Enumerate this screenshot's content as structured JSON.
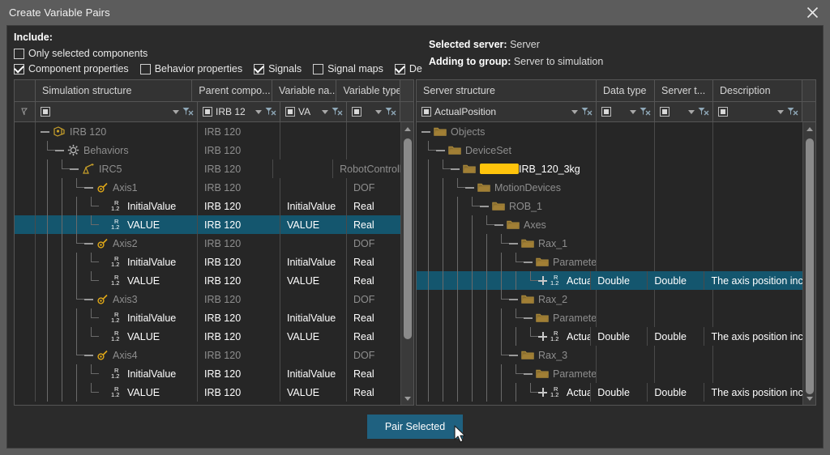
{
  "window": {
    "title": "Create Variable Pairs",
    "close_icon": "close-icon"
  },
  "include": {
    "label": "Include:",
    "checkboxes": [
      {
        "label": "Only selected components",
        "checked": false
      },
      {
        "label": "Component properties",
        "checked": true
      },
      {
        "label": "Behavior properties",
        "checked": false
      },
      {
        "label": "Signals",
        "checked": true
      },
      {
        "label": "Signal maps",
        "checked": false
      },
      {
        "label": "Degrees of",
        "checked": true
      }
    ]
  },
  "server_info": {
    "selected_server_label": "Selected server:",
    "selected_server_value": "Server",
    "adding_to_group_label": "Adding to group:",
    "adding_to_group_value": "Server to simulation"
  },
  "left_panel": {
    "columns": [
      "Simulation structure",
      "Parent compo...",
      "Variable na...",
      "Variable type"
    ],
    "filters": [
      {
        "value": "",
        "icon": "filter-box-icon",
        "clear_icon": "clear-filter-icon"
      },
      {
        "value": "IRB 12",
        "icon": "filter-box-icon",
        "clear_icon": "clear-filter-icon"
      },
      {
        "value": "VA",
        "icon": "filter-box-icon",
        "clear_icon": "clear-filter-icon"
      },
      {
        "value": "",
        "icon": "filter-box-icon",
        "clear_icon": "clear-filter-icon"
      }
    ],
    "rows": [
      {
        "name": "IRB 120",
        "depth": 0,
        "icon": "robot-component-icon",
        "expander": "minus",
        "dim": true,
        "parent": "IRB 120",
        "varname": "",
        "vartype": "",
        "selected": false
      },
      {
        "name": "Behaviors",
        "depth": 1,
        "icon": "gear-icon",
        "expander": "minus",
        "dim": true,
        "parent": "IRB 120",
        "varname": "",
        "vartype": "",
        "selected": false
      },
      {
        "name": "IRC5",
        "depth": 2,
        "icon": "controller-icon",
        "expander": "minus",
        "dim": true,
        "parent": "IRB 120",
        "varname": "",
        "vartype": "RobotControlle",
        "selected": false
      },
      {
        "name": "Axis1",
        "depth": 3,
        "icon": "axis-icon",
        "expander": "minus",
        "dim": true,
        "parent": "IRB 120",
        "varname": "",
        "vartype": "DOF",
        "selected": false
      },
      {
        "name": "InitialValue",
        "depth": 4,
        "icon": "real-variable-icon",
        "expander": "none",
        "dim": false,
        "parent": "IRB 120",
        "varname": "InitialValue",
        "vartype": "Real",
        "selected": false
      },
      {
        "name": "VALUE",
        "depth": 4,
        "icon": "real-variable-icon",
        "expander": "none",
        "dim": false,
        "parent": "IRB 120",
        "varname": "VALUE",
        "vartype": "Real",
        "selected": true
      },
      {
        "name": "Axis2",
        "depth": 3,
        "icon": "axis-icon",
        "expander": "minus",
        "dim": true,
        "parent": "IRB 120",
        "varname": "",
        "vartype": "DOF",
        "selected": false
      },
      {
        "name": "InitialValue",
        "depth": 4,
        "icon": "real-variable-icon",
        "expander": "none",
        "dim": false,
        "parent": "IRB 120",
        "varname": "InitialValue",
        "vartype": "Real",
        "selected": false
      },
      {
        "name": "VALUE",
        "depth": 4,
        "icon": "real-variable-icon",
        "expander": "none",
        "dim": false,
        "parent": "IRB 120",
        "varname": "VALUE",
        "vartype": "Real",
        "selected": false
      },
      {
        "name": "Axis3",
        "depth": 3,
        "icon": "axis-icon",
        "expander": "minus",
        "dim": true,
        "parent": "IRB 120",
        "varname": "",
        "vartype": "DOF",
        "selected": false
      },
      {
        "name": "InitialValue",
        "depth": 4,
        "icon": "real-variable-icon",
        "expander": "none",
        "dim": false,
        "parent": "IRB 120",
        "varname": "InitialValue",
        "vartype": "Real",
        "selected": false
      },
      {
        "name": "VALUE",
        "depth": 4,
        "icon": "real-variable-icon",
        "expander": "none",
        "dim": false,
        "parent": "IRB 120",
        "varname": "VALUE",
        "vartype": "Real",
        "selected": false
      },
      {
        "name": "Axis4",
        "depth": 3,
        "icon": "axis-icon",
        "expander": "minus",
        "dim": true,
        "parent": "IRB 120",
        "varname": "",
        "vartype": "DOF",
        "selected": false
      },
      {
        "name": "InitialValue",
        "depth": 4,
        "icon": "real-variable-icon",
        "expander": "none",
        "dim": false,
        "parent": "IRB 120",
        "varname": "InitialValue",
        "vartype": "Real",
        "selected": false
      },
      {
        "name": "VALUE",
        "depth": 4,
        "icon": "real-variable-icon",
        "expander": "none",
        "dim": false,
        "parent": "IRB 120",
        "varname": "VALUE",
        "vartype": "Real",
        "selected": false
      }
    ]
  },
  "right_panel": {
    "columns": [
      "Server structure",
      "Data type",
      "Server t...",
      "Description"
    ],
    "filters": [
      {
        "value": "ActualPosition",
        "icon": "filter-box-icon",
        "clear_icon": "clear-filter-icon"
      },
      {
        "value": "",
        "icon": "filter-box-icon",
        "clear_icon": "clear-filter-icon"
      },
      {
        "value": "",
        "icon": "filter-box-icon",
        "clear_icon": "clear-filter-icon"
      },
      {
        "value": "",
        "icon": "filter-box-icon",
        "clear_icon": "clear-filter-icon"
      }
    ],
    "rows": [
      {
        "name": "Objects",
        "depth": 0,
        "icon": "folder-icon",
        "expander": "minus",
        "dim": true,
        "redacted": false,
        "datatype": "",
        "servertype": "",
        "description": "",
        "selected": false
      },
      {
        "name": "DeviceSet",
        "depth": 1,
        "icon": "folder-icon",
        "expander": "minus",
        "dim": true,
        "redacted": false,
        "datatype": "",
        "servertype": "",
        "description": "",
        "selected": false
      },
      {
        "name": "IRB_120_3kg",
        "depth": 2,
        "icon": "folder-icon",
        "expander": "minus",
        "dim": false,
        "redacted": true,
        "datatype": "",
        "servertype": "",
        "description": "",
        "selected": false
      },
      {
        "name": "MotionDevices",
        "depth": 3,
        "icon": "folder-icon",
        "expander": "minus",
        "dim": true,
        "redacted": false,
        "datatype": "",
        "servertype": "",
        "description": "",
        "selected": false
      },
      {
        "name": "ROB_1",
        "depth": 4,
        "icon": "folder-icon",
        "expander": "minus",
        "dim": true,
        "redacted": false,
        "datatype": "",
        "servertype": "",
        "description": "",
        "selected": false
      },
      {
        "name": "Axes",
        "depth": 5,
        "icon": "folder-icon",
        "expander": "minus",
        "dim": true,
        "redacted": false,
        "datatype": "",
        "servertype": "",
        "description": "",
        "selected": false
      },
      {
        "name": "Rax_1",
        "depth": 6,
        "icon": "folder-icon",
        "expander": "minus",
        "dim": true,
        "redacted": false,
        "datatype": "",
        "servertype": "",
        "description": "",
        "selected": false
      },
      {
        "name": "ParameterSet",
        "depth": 7,
        "icon": "folder-icon",
        "expander": "minus",
        "dim": true,
        "redacted": false,
        "datatype": "",
        "servertype": "",
        "description": "",
        "selected": false
      },
      {
        "name": "ActualPosition",
        "depth": 8,
        "icon": "real-variable-icon",
        "expander": "plus",
        "dim": false,
        "redacted": false,
        "datatype": "Double",
        "servertype": "Double",
        "description": "The axis position incl",
        "selected": true
      },
      {
        "name": "Rax_2",
        "depth": 6,
        "icon": "folder-icon",
        "expander": "minus",
        "dim": true,
        "redacted": false,
        "datatype": "",
        "servertype": "",
        "description": "",
        "selected": false
      },
      {
        "name": "ParameterSet",
        "depth": 7,
        "icon": "folder-icon",
        "expander": "minus",
        "dim": true,
        "redacted": false,
        "datatype": "",
        "servertype": "",
        "description": "",
        "selected": false
      },
      {
        "name": "ActualPosition",
        "depth": 8,
        "icon": "real-variable-icon",
        "expander": "plus",
        "dim": false,
        "redacted": false,
        "datatype": "Double",
        "servertype": "Double",
        "description": "The axis position incl",
        "selected": false
      },
      {
        "name": "Rax_3",
        "depth": 6,
        "icon": "folder-icon",
        "expander": "minus",
        "dim": true,
        "redacted": false,
        "datatype": "",
        "servertype": "",
        "description": "",
        "selected": false
      },
      {
        "name": "ParameterSet",
        "depth": 7,
        "icon": "folder-icon",
        "expander": "minus",
        "dim": true,
        "redacted": false,
        "datatype": "",
        "servertype": "",
        "description": "",
        "selected": false
      },
      {
        "name": "ActualPosition",
        "depth": 8,
        "icon": "real-variable-icon",
        "expander": "plus",
        "dim": false,
        "redacted": false,
        "datatype": "Double",
        "servertype": "Double",
        "description": "The axis position incl",
        "selected": false
      }
    ]
  },
  "footer": {
    "pair_selected_label": "Pair Selected"
  },
  "colors": {
    "selection": "#14566e",
    "accent_button": "#1f6180",
    "redaction": "#ffc40c",
    "title_bar": "#5c5c5c",
    "panel_bg": "#262626",
    "dialog_bg": "#2b2b2b"
  }
}
